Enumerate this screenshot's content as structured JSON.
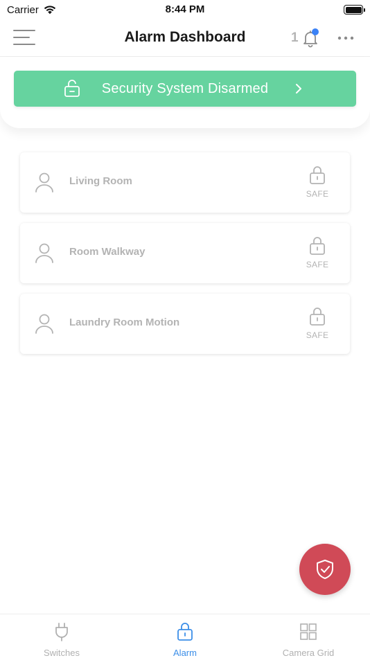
{
  "status_bar": {
    "carrier": "Carrier",
    "time": "8:44 PM"
  },
  "nav": {
    "title": "Alarm Dashboard",
    "notification_count": "1",
    "notification_dot_color": "#3b82f6"
  },
  "banner": {
    "text": "Security System Disarmed",
    "color": "#66d39f"
  },
  "zones": [
    {
      "name": "Living Room",
      "status": "SAFE"
    },
    {
      "name": "Room Walkway",
      "status": "SAFE"
    },
    {
      "name": "Laundry Room Motion",
      "status": "SAFE"
    }
  ],
  "fab": {
    "icon": "shield-check-icon",
    "color": "#d04a57"
  },
  "tabs": [
    {
      "label": "Switches",
      "icon": "plug-icon",
      "active": false
    },
    {
      "label": "Alarm",
      "icon": "lock-icon",
      "active": true
    },
    {
      "label": "Camera Grid",
      "icon": "grid-icon",
      "active": false
    }
  ],
  "colors": {
    "active_tab": "#3b8ee8",
    "inactive_tab": "#b0b0b0",
    "muted_text": "#b3b3b3"
  }
}
